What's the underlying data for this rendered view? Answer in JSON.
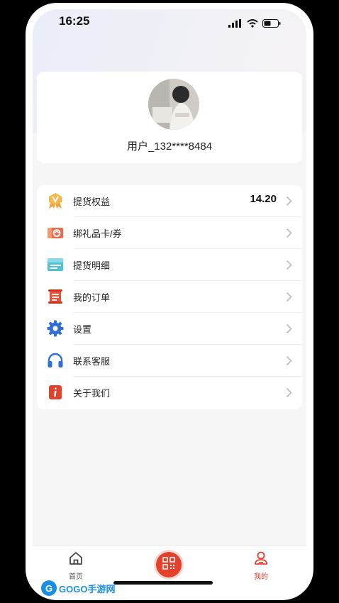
{
  "status_bar": {
    "time": "16:25"
  },
  "profile": {
    "username": "用户_132****8484"
  },
  "menu": [
    {
      "key": "pickup-rights",
      "icon": "badge-icon",
      "label": "提货权益",
      "value": "14.20"
    },
    {
      "key": "bind-gift-card",
      "icon": "gift-card-icon",
      "label": "绑礼品卡/券",
      "value": ""
    },
    {
      "key": "pickup-details",
      "icon": "ledger-icon",
      "label": "提货明细",
      "value": ""
    },
    {
      "key": "my-orders",
      "icon": "scroll-icon",
      "label": "我的订单",
      "value": ""
    },
    {
      "key": "settings",
      "icon": "gear-icon",
      "label": "设置",
      "value": ""
    },
    {
      "key": "customer-service",
      "icon": "headphones-icon",
      "label": "联系客服",
      "value": ""
    },
    {
      "key": "about-us",
      "icon": "info-icon",
      "label": "关于我们",
      "value": ""
    }
  ],
  "tab_bar": {
    "home_label": "首页",
    "mine_label": "我的",
    "active": "mine",
    "accent_color": "#e4412d"
  },
  "watermark": {
    "circle": "G",
    "text": "GOGO手游网"
  }
}
